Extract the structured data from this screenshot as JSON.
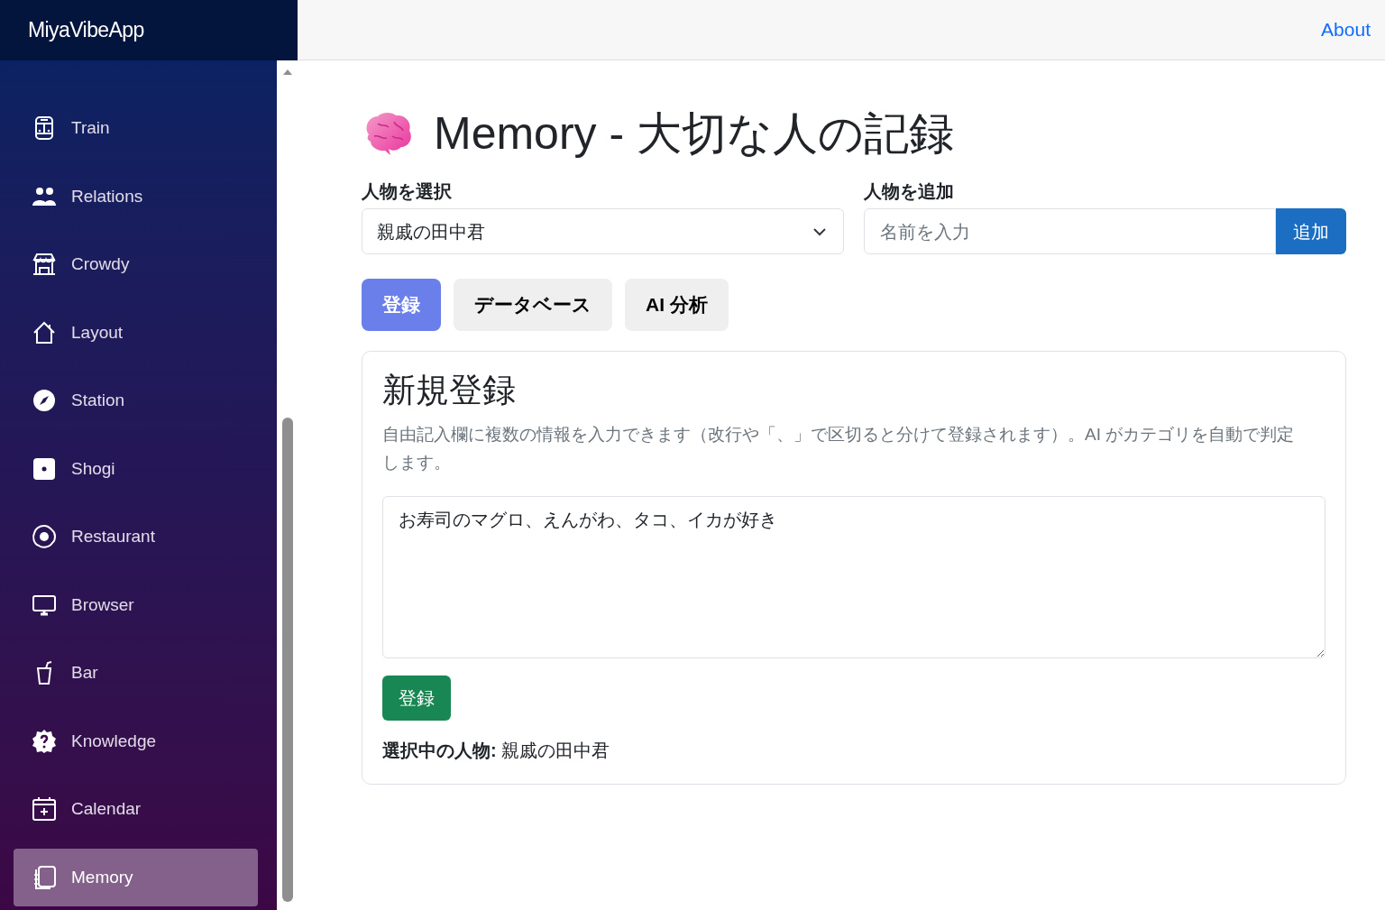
{
  "app_title": "MiyaVibeApp",
  "header_link": "About",
  "sidebar": {
    "items": [
      {
        "label": "Train",
        "selected": false
      },
      {
        "label": "Relations",
        "selected": false
      },
      {
        "label": "Crowdy",
        "selected": false
      },
      {
        "label": "Layout",
        "selected": false
      },
      {
        "label": "Station",
        "selected": false
      },
      {
        "label": "Shogi",
        "selected": false
      },
      {
        "label": "Restaurant",
        "selected": false
      },
      {
        "label": "Browser",
        "selected": false
      },
      {
        "label": "Bar",
        "selected": false
      },
      {
        "label": "Knowledge",
        "selected": false
      },
      {
        "label": "Calendar",
        "selected": false
      },
      {
        "label": "Memory",
        "selected": true
      }
    ]
  },
  "page_title": "Memory - 大切な人の記録",
  "select_person": {
    "label": "人物を選択",
    "value": "親戚の田中君"
  },
  "add_person": {
    "label": "人物を追加",
    "placeholder": "名前を入力",
    "button": "追加"
  },
  "tabs": [
    {
      "label": "登録",
      "selected": true
    },
    {
      "label": "データベース",
      "selected": false
    },
    {
      "label": "AI 分析",
      "selected": false
    }
  ],
  "card": {
    "title": "新規登録",
    "description": "自由記入欄に複数の情報を入力できます（改行や「、」で区切ると分けて登録されます）。AI がカテゴリを自動で判定します。",
    "text": "お寿司のマグロ、えんがわ、タコ、イカが好き",
    "button": "登録",
    "selected_person": "**選択中の人物:** 親戚の田中君"
  }
}
